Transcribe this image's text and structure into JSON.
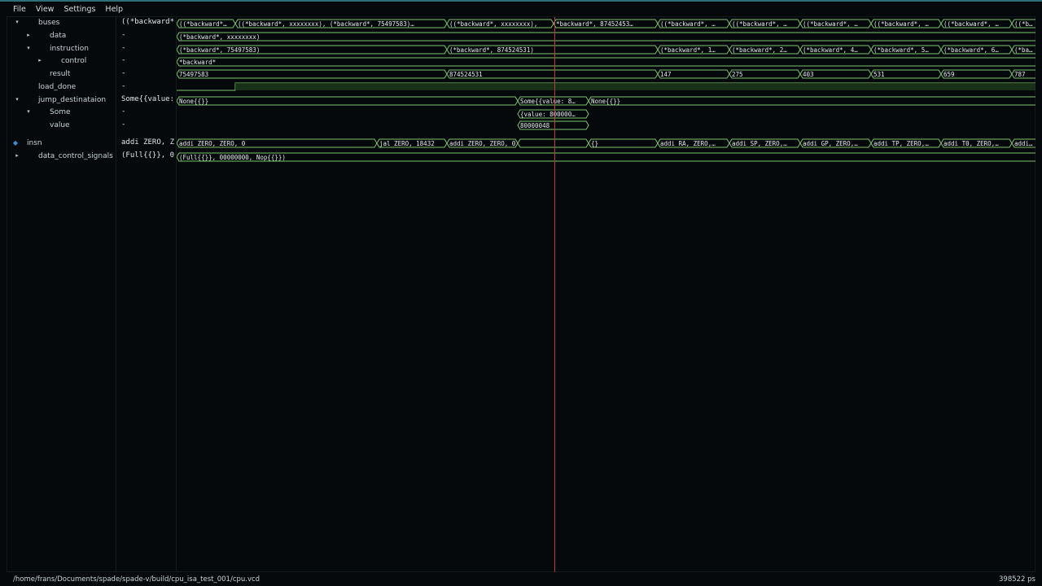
{
  "menu": [
    "File",
    "View",
    "Settings",
    "Help"
  ],
  "tree": [
    {
      "label": "buses",
      "tri": "▾",
      "indent": 0,
      "value": "((*backward*",
      "name": "buses"
    },
    {
      "label": "data",
      "tri": "▸",
      "indent": 1,
      "value": "-",
      "name": "data"
    },
    {
      "label": "instruction",
      "tri": "▾",
      "indent": 1,
      "value": "-",
      "name": "instruction"
    },
    {
      "label": "control",
      "tri": "▸",
      "indent": 2,
      "value": "-",
      "name": "control"
    },
    {
      "label": "result",
      "tri": "",
      "indent": 1,
      "value": "-",
      "name": "result"
    },
    {
      "label": "load_done",
      "tri": "",
      "indent": 0,
      "value": "-",
      "name": "load-done"
    },
    {
      "label": "jump_destinataion",
      "tri": "▾",
      "indent": 0,
      "value": "Some{{value:",
      "name": "jump-destinataion"
    },
    {
      "label": "Some",
      "tri": "▾",
      "indent": 1,
      "value": "-",
      "name": "some"
    },
    {
      "label": "value",
      "tri": "",
      "indent": 1,
      "value": "-",
      "name": "value"
    },
    {
      "label": "insn",
      "tri": "◆",
      "indent": -1,
      "value": "addi ZERO, Z",
      "name": "insn"
    },
    {
      "label": "data_control_signals",
      "tri": "▸",
      "indent": 0,
      "value": "(Full{{}}, 0",
      "name": "data-control-signals"
    }
  ],
  "colors": {
    "wave": "#7ec46d",
    "cursor": "#c0393b",
    "marker": "#3a8fd6"
  },
  "waves": {
    "buses": [
      "((*backward*…",
      "((*backward*, xxxxxxxx), (*backward*, 75497583)…",
      "((*backward*, xxxxxxxx),",
      "*backward*, 87452453…",
      "((*backward*, …",
      "((*backward*, …",
      "((*backward*, …",
      "((*backward*, …",
      "((*backward*, …",
      "((*b…"
    ],
    "data": [
      "(*backward*, xxxxxxxx)"
    ],
    "instruction": [
      "(*backward*, 75497583)",
      "(*backward*, 874524531)",
      "(*backward*, 1…",
      "(*backward*, 2…",
      "(*backward*, 4…",
      "(*backward*, 5…",
      "(*backward*, 6…",
      "(*ba…"
    ],
    "control": [
      "*backward*"
    ],
    "result": [
      "75497583",
      "874524531",
      "147",
      "275",
      "403",
      "531",
      "659",
      "787"
    ],
    "jump": [
      "None{{}}",
      "Some{{value: 8…",
      "None{{}}"
    ],
    "some": [
      "{value: 800000…"
    ],
    "value": [
      "80000048"
    ],
    "insn": [
      "addi ZERO, ZERO, 0",
      "jal ZERO, 18432",
      "addi ZERO, ZERO, 0",
      "{}",
      "addi RA, ZERO,…",
      "addi SP, ZERO,…",
      "addi GP, ZERO,…",
      "addi TP, ZERO,…",
      "addi T0, ZERO,…",
      "addi…"
    ],
    "dcs": [
      "(Full{{}}, 00000000, Nop{{}})"
    ]
  },
  "status": {
    "path": "/home/frans/Documents/spade/spade-v/build/cpu_isa_test_001/cpu.vcd",
    "time": "398522 ps"
  }
}
